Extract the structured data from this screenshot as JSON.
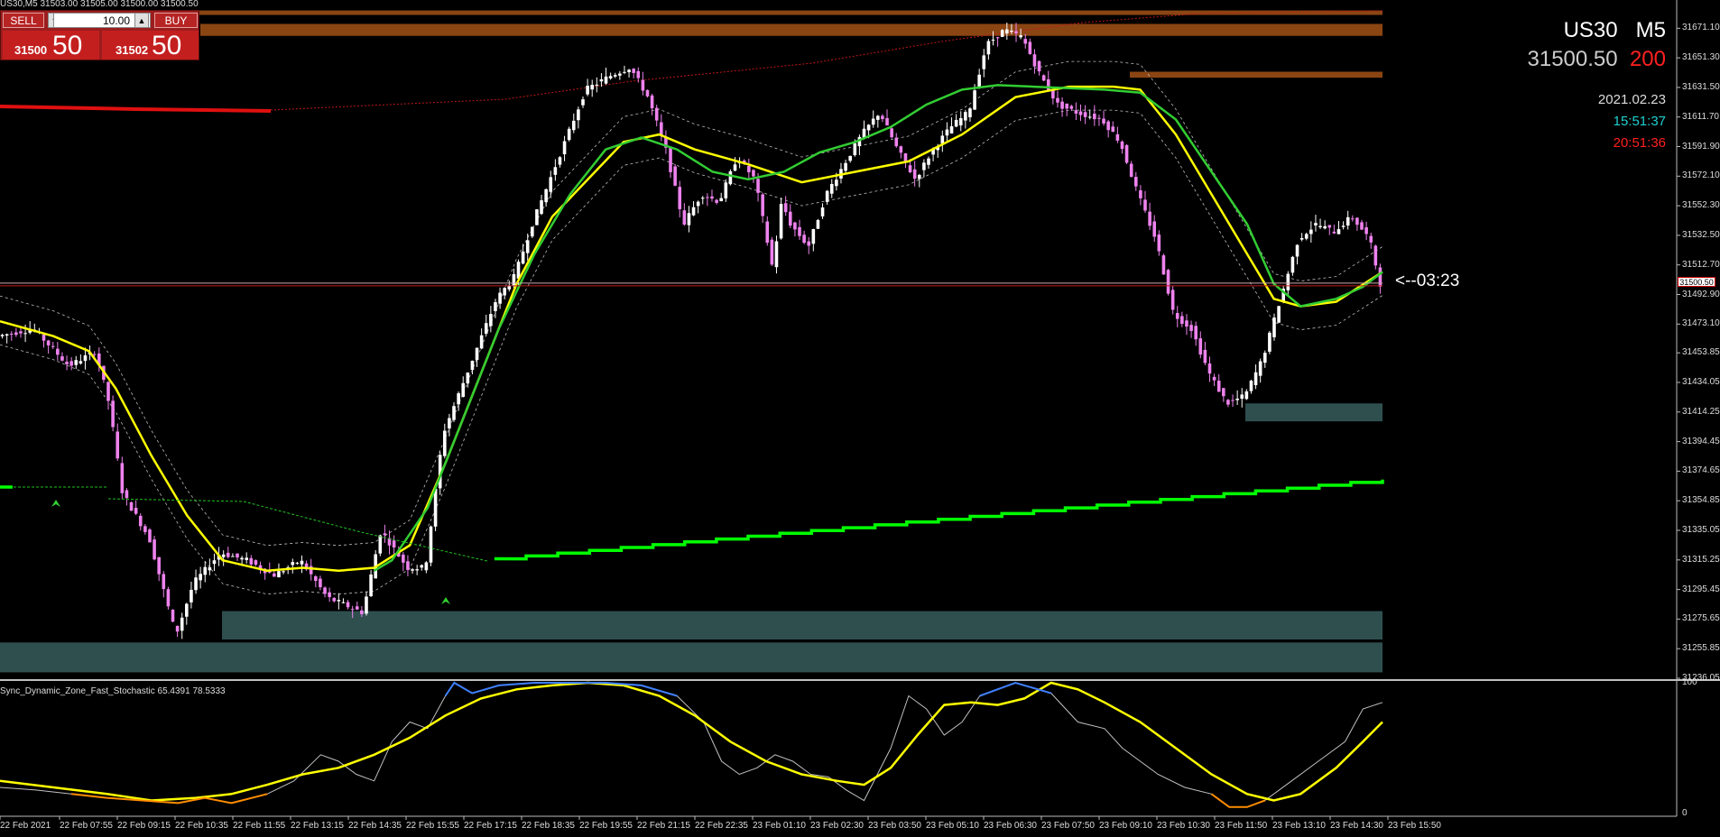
{
  "header": {
    "symbol_line": "US30,M5  31503.00 31505.00 31500.00 31500.50"
  },
  "trade_panel": {
    "sell_label": "SELL",
    "buy_label": "BUY",
    "lots": "10.00",
    "spin_down": "▼",
    "spin_up": "▲",
    "sell_price_small": "31500",
    "sell_price_big": "50",
    "buy_price_small": "31502",
    "buy_price_big": "50"
  },
  "info": {
    "symbol": "US30",
    "timeframe": "M5",
    "price": "31500.50",
    "spread": "200",
    "date": "2021.02.23",
    "time_server": "15:51:37",
    "time_local": "20:51:36",
    "countdown": "<--03:23",
    "price_tag": "31500.50"
  },
  "colors": {
    "bull_candle": "#ffffff",
    "bear_candle": "#ee82ee",
    "ma_fast": "#ffff00",
    "ma_slow": "#32cd32",
    "trend_line": "#00ff00",
    "zone_supply": "#8b4513",
    "zone_demand": "#2f4f4f",
    "stoch_main": "#c0c0c0",
    "stoch_signal": "#ffff00",
    "stoch_high": "#4080ff",
    "stoch_low": "#ff8c00"
  },
  "chart_data": [
    {
      "type": "candlestick",
      "ylim": [
        31236.05,
        31690.0
      ],
      "yticks": [
        "31671.10",
        "31651.30",
        "31631.50",
        "31611.70",
        "31591.90",
        "31572.10",
        "31552.30",
        "31532.50",
        "31512.70",
        "31492.90",
        "31473.10",
        "31453.85",
        "31434.05",
        "31414.25",
        "31394.45",
        "31374.65",
        "31354.85",
        "31335.05",
        "31315.25",
        "31295.45",
        "31275.65",
        "31255.85",
        "31236.05"
      ],
      "xticks": [
        "22 Feb 2021",
        "22 Feb 07:55",
        "22 Feb 09:15",
        "22 Feb 10:35",
        "22 Feb 11:55",
        "22 Feb 13:15",
        "22 Feb 14:35",
        "22 Feb 15:55",
        "22 Feb 17:15",
        "22 Feb 18:35",
        "22 Feb 19:55",
        "22 Feb 21:15",
        "22 Feb 22:35",
        "23 Feb 01:10",
        "23 Feb 02:30",
        "23 Feb 03:50",
        "23 Feb 05:10",
        "23 Feb 06:30",
        "23 Feb 07:50",
        "23 Feb 09:10",
        "23 Feb 10:30",
        "23 Feb 11:50",
        "23 Feb 13:10",
        "23 Feb 14:30",
        "23 Feb 15:50"
      ],
      "price_path": [
        [
          0,
          31465
        ],
        [
          40,
          31470
        ],
        [
          80,
          31445
        ],
        [
          110,
          31455
        ],
        [
          125,
          31420
        ],
        [
          140,
          31360
        ],
        [
          170,
          31330
        ],
        [
          200,
          31265
        ],
        [
          220,
          31300
        ],
        [
          250,
          31320
        ],
        [
          280,
          31315
        ],
        [
          310,
          31305
        ],
        [
          340,
          31315
        ],
        [
          370,
          31290
        ],
        [
          390,
          31285
        ],
        [
          410,
          31280
        ],
        [
          430,
          31335
        ],
        [
          460,
          31310
        ],
        [
          480,
          31310
        ],
        [
          500,
          31400
        ],
        [
          520,
          31430
        ],
        [
          540,
          31460
        ],
        [
          560,
          31490
        ],
        [
          580,
          31505
        ],
        [
          600,
          31540
        ],
        [
          620,
          31570
        ],
        [
          640,
          31600
        ],
        [
          660,
          31630
        ],
        [
          690,
          31640
        ],
        [
          710,
          31645
        ],
        [
          730,
          31625
        ],
        [
          750,
          31590
        ],
        [
          770,
          31540
        ],
        [
          790,
          31560
        ],
        [
          810,
          31555
        ],
        [
          830,
          31585
        ],
        [
          850,
          31570
        ],
        [
          870,
          31510
        ],
        [
          880,
          31555
        ],
        [
          890,
          31540
        ],
        [
          910,
          31525
        ],
        [
          930,
          31560
        ],
        [
          950,
          31580
        ],
        [
          970,
          31600
        ],
        [
          990,
          31615
        ],
        [
          1010,
          31590
        ],
        [
          1030,
          31570
        ],
        [
          1050,
          31590
        ],
        [
          1070,
          31605
        ],
        [
          1090,
          31615
        ],
        [
          1110,
          31660
        ],
        [
          1130,
          31670
        ],
        [
          1150,
          31665
        ],
        [
          1170,
          31640
        ],
        [
          1190,
          31620
        ],
        [
          1210,
          31615
        ],
        [
          1240,
          31610
        ],
        [
          1260,
          31595
        ],
        [
          1280,
          31560
        ],
        [
          1300,
          31530
        ],
        [
          1320,
          31480
        ],
        [
          1340,
          31470
        ],
        [
          1360,
          31440
        ],
        [
          1380,
          31420
        ],
        [
          1400,
          31425
        ],
        [
          1420,
          31450
        ],
        [
          1440,
          31490
        ],
        [
          1460,
          31530
        ],
        [
          1480,
          31540
        ],
        [
          1500,
          31535
        ],
        [
          1520,
          31545
        ],
        [
          1540,
          31530
        ],
        [
          1552,
          31500
        ]
      ],
      "ma_fast": [
        [
          0,
          31475
        ],
        [
          60,
          31465
        ],
        [
          100,
          31455
        ],
        [
          130,
          31430
        ],
        [
          170,
          31385
        ],
        [
          210,
          31345
        ],
        [
          250,
          31315
        ],
        [
          300,
          31308
        ],
        [
          340,
          31310
        ],
        [
          380,
          31308
        ],
        [
          420,
          31310
        ],
        [
          460,
          31325
        ],
        [
          500,
          31380
        ],
        [
          540,
          31440
        ],
        [
          580,
          31500
        ],
        [
          620,
          31545
        ],
        [
          660,
          31570
        ],
        [
          700,
          31595
        ],
        [
          740,
          31600
        ],
        [
          780,
          31590
        ],
        [
          840,
          31580
        ],
        [
          900,
          31568
        ],
        [
          960,
          31575
        ],
        [
          1020,
          31582
        ],
        [
          1080,
          31600
        ],
        [
          1140,
          31625
        ],
        [
          1200,
          31632
        ],
        [
          1250,
          31632
        ],
        [
          1280,
          31630
        ],
        [
          1320,
          31600
        ],
        [
          1360,
          31560
        ],
        [
          1400,
          31520
        ],
        [
          1430,
          31490
        ],
        [
          1460,
          31485
        ],
        [
          1500,
          31488
        ],
        [
          1552,
          31508
        ]
      ],
      "ma_slow": [
        [
          420,
          31308
        ],
        [
          440,
          31315
        ],
        [
          480,
          31350
        ],
        [
          520,
          31410
        ],
        [
          560,
          31470
        ],
        [
          600,
          31520
        ],
        [
          640,
          31560
        ],
        [
          680,
          31590
        ],
        [
          720,
          31598
        ],
        [
          760,
          31590
        ],
        [
          800,
          31575
        ],
        [
          840,
          31570
        ],
        [
          880,
          31575
        ],
        [
          920,
          31588
        ],
        [
          960,
          31595
        ],
        [
          1000,
          31605
        ],
        [
          1040,
          31620
        ],
        [
          1080,
          31630
        ],
        [
          1120,
          31633
        ],
        [
          1160,
          31632
        ],
        [
          1200,
          31631
        ],
        [
          1240,
          31630
        ],
        [
          1280,
          31628
        ],
        [
          1320,
          31610
        ],
        [
          1360,
          31575
        ],
        [
          1400,
          31540
        ],
        [
          1430,
          31500
        ],
        [
          1460,
          31485
        ],
        [
          1500,
          31490
        ],
        [
          1530,
          31498
        ],
        [
          1552,
          31508
        ]
      ],
      "zones": [
        {
          "name": "supply-1",
          "y0": 31683,
          "y1": 31680
        },
        {
          "name": "supply-2",
          "y0": 31674,
          "y1": 31666
        },
        {
          "name": "supply-3",
          "y0": 31642,
          "y1": 31638
        },
        {
          "name": "demand-1",
          "y0": 31420,
          "y1": 31408
        },
        {
          "name": "demand-2",
          "y0": 31281,
          "y1": 31262
        },
        {
          "name": "demand-3",
          "y0": 31260,
          "y1": 31240
        }
      ],
      "current_price": 31500.5,
      "trend_line": [
        [
          555,
          31316
        ],
        [
          1552,
          31369
        ]
      ]
    },
    {
      "type": "line",
      "title": "Sync_Dynamic_Zone_Fast_Stochastic 65.4391 78.5333",
      "ylim": [
        0,
        100
      ],
      "yticks": [
        "100",
        "0"
      ],
      "main": [
        [
          0,
          20
        ],
        [
          40,
          18
        ],
        [
          80,
          15
        ],
        [
          120,
          12
        ],
        [
          160,
          10
        ],
        [
          200,
          8
        ],
        [
          230,
          12
        ],
        [
          260,
          8
        ],
        [
          300,
          15
        ],
        [
          330,
          25
        ],
        [
          360,
          45
        ],
        [
          380,
          40
        ],
        [
          400,
          30
        ],
        [
          420,
          25
        ],
        [
          440,
          55
        ],
        [
          460,
          70
        ],
        [
          480,
          65
        ],
        [
          500,
          90
        ],
        [
          510,
          100
        ],
        [
          530,
          92
        ],
        [
          560,
          98
        ],
        [
          600,
          100
        ],
        [
          640,
          100
        ],
        [
          680,
          100
        ],
        [
          720,
          98
        ],
        [
          760,
          90
        ],
        [
          790,
          70
        ],
        [
          810,
          40
        ],
        [
          830,
          30
        ],
        [
          850,
          35
        ],
        [
          870,
          45
        ],
        [
          890,
          40
        ],
        [
          910,
          30
        ],
        [
          930,
          28
        ],
        [
          950,
          18
        ],
        [
          970,
          10
        ],
        [
          1000,
          50
        ],
        [
          1020,
          90
        ],
        [
          1040,
          80
        ],
        [
          1060,
          60
        ],
        [
          1080,
          70
        ],
        [
          1100,
          90
        ],
        [
          1140,
          100
        ],
        [
          1180,
          92
        ],
        [
          1210,
          70
        ],
        [
          1240,
          65
        ],
        [
          1260,
          50
        ],
        [
          1280,
          40
        ],
        [
          1300,
          30
        ],
        [
          1330,
          20
        ],
        [
          1360,
          15
        ],
        [
          1380,
          5
        ],
        [
          1400,
          5
        ],
        [
          1420,
          10
        ],
        [
          1450,
          25
        ],
        [
          1480,
          40
        ],
        [
          1510,
          55
        ],
        [
          1530,
          80
        ],
        [
          1552,
          85
        ]
      ],
      "signal": [
        [
          0,
          25
        ],
        [
          60,
          20
        ],
        [
          120,
          15
        ],
        [
          170,
          10
        ],
        [
          220,
          12
        ],
        [
          260,
          15
        ],
        [
          300,
          22
        ],
        [
          340,
          30
        ],
        [
          380,
          35
        ],
        [
          420,
          45
        ],
        [
          460,
          58
        ],
        [
          500,
          75
        ],
        [
          540,
          88
        ],
        [
          580,
          95
        ],
        [
          620,
          98
        ],
        [
          660,
          100
        ],
        [
          700,
          98
        ],
        [
          740,
          90
        ],
        [
          780,
          75
        ],
        [
          820,
          55
        ],
        [
          860,
          40
        ],
        [
          900,
          30
        ],
        [
          940,
          25
        ],
        [
          970,
          22
        ],
        [
          1000,
          35
        ],
        [
          1030,
          60
        ],
        [
          1060,
          83
        ],
        [
          1090,
          85
        ],
        [
          1120,
          83
        ],
        [
          1150,
          88
        ],
        [
          1180,
          100
        ],
        [
          1210,
          95
        ],
        [
          1240,
          85
        ],
        [
          1280,
          70
        ],
        [
          1320,
          50
        ],
        [
          1360,
          30
        ],
        [
          1400,
          15
        ],
        [
          1430,
          10
        ],
        [
          1460,
          15
        ],
        [
          1500,
          35
        ],
        [
          1530,
          55
        ],
        [
          1552,
          70
        ]
      ]
    }
  ]
}
